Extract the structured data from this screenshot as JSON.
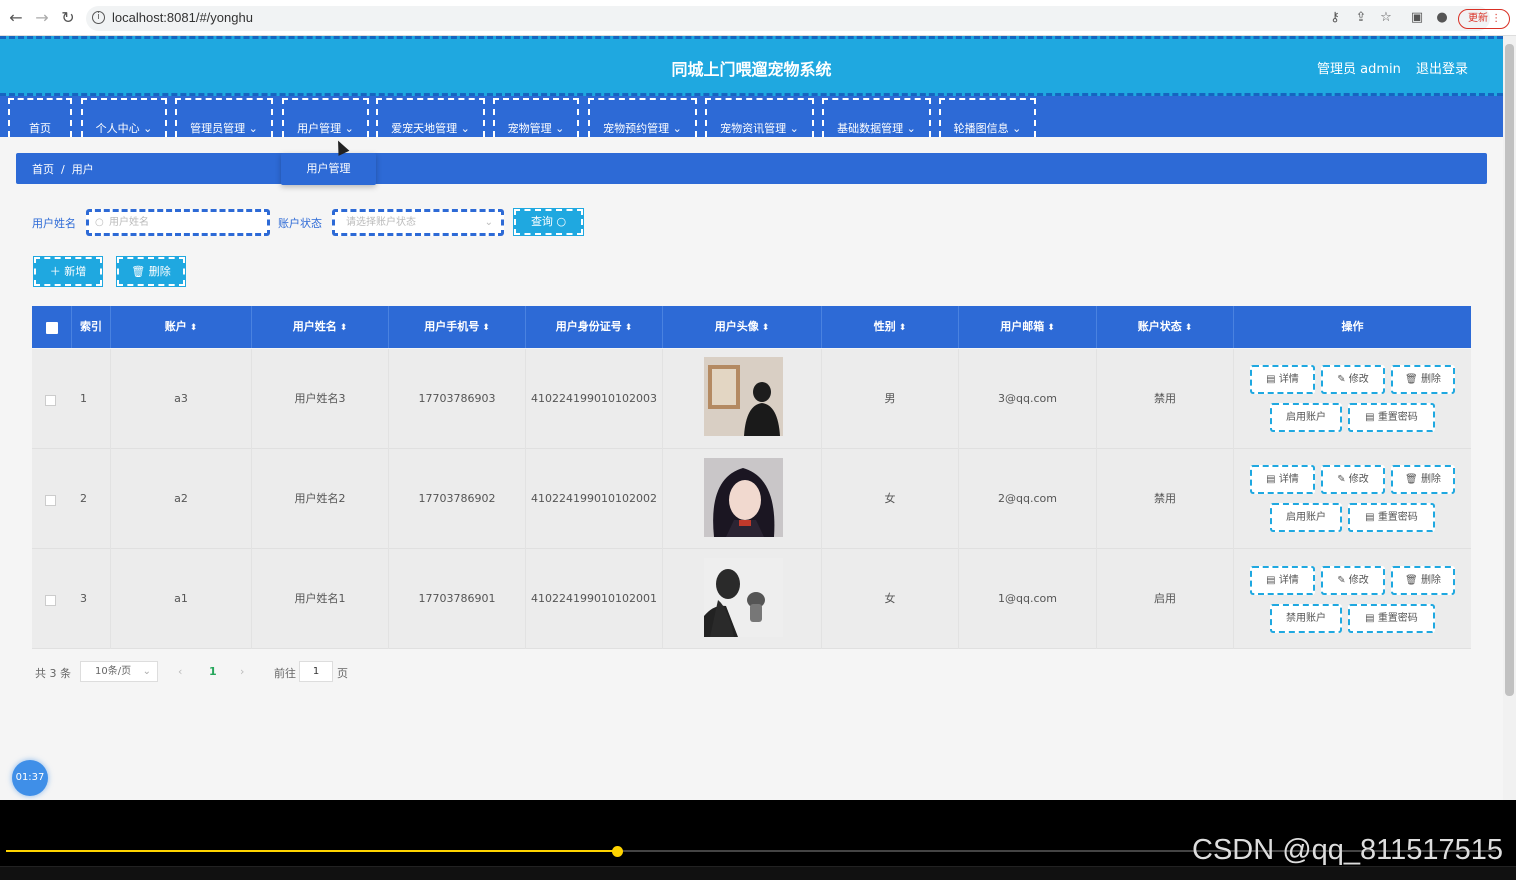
{
  "browser": {
    "url": "localhost:8081/#/yonghu",
    "update_label": "更新"
  },
  "header": {
    "title": "同城上门喂遛宠物系统",
    "admin": "管理员 admin",
    "logout": "退出登录"
  },
  "menu": [
    "首页",
    "个人中心",
    "管理员管理",
    "用户管理",
    "爱宠天地管理",
    "宠物管理",
    "宠物预约管理",
    "宠物资讯管理",
    "基础数据管理",
    "轮播图信息"
  ],
  "dropdown": {
    "item": "用户管理"
  },
  "breadcrumb": {
    "home": "首页",
    "sep": "/",
    "current": "用户"
  },
  "search": {
    "name_label": "用户姓名",
    "name_placeholder": "用户姓名",
    "status_label": "账户状态",
    "status_placeholder": "请选择账户状态",
    "query_label": "查询"
  },
  "actions": {
    "add": "新增",
    "delete": "删除"
  },
  "table": {
    "headers": [
      "索引",
      "账户",
      "用户姓名",
      "用户手机号",
      "用户身份证号",
      "用户头像",
      "性别",
      "用户邮箱",
      "账户状态",
      "操作"
    ],
    "rows": [
      {
        "index": "1",
        "account": "a3",
        "name": "用户姓名3",
        "phone": "17703786903",
        "id_card": "410224199010102003",
        "gender": "男",
        "email": "3@qq.com",
        "status": "禁用",
        "toggle_label": "启用账户"
      },
      {
        "index": "2",
        "account": "a2",
        "name": "用户姓名2",
        "phone": "17703786902",
        "id_card": "410224199010102002",
        "gender": "女",
        "email": "2@qq.com",
        "status": "禁用",
        "toggle_label": "启用账户"
      },
      {
        "index": "3",
        "account": "a1",
        "name": "用户姓名1",
        "phone": "17703786901",
        "id_card": "410224199010102001",
        "gender": "女",
        "email": "1@qq.com",
        "status": "启用",
        "toggle_label": "禁用账户"
      }
    ],
    "ops": {
      "detail": "详情",
      "edit": "修改",
      "delete": "删除",
      "reset": "重置密码"
    }
  },
  "pagination": {
    "total": "共 3 条",
    "page_size": "10条/页",
    "current": "1",
    "goto": "前往",
    "goto_value": "1",
    "page_unit": "页"
  },
  "timer": "01:37",
  "video": {
    "progress": 0.41,
    "watermark": "CSDN @qq_811517515"
  },
  "colors": {
    "header": "#1fa8e0",
    "menu": "#2d6ad6",
    "accent": "#1fa8e0"
  }
}
